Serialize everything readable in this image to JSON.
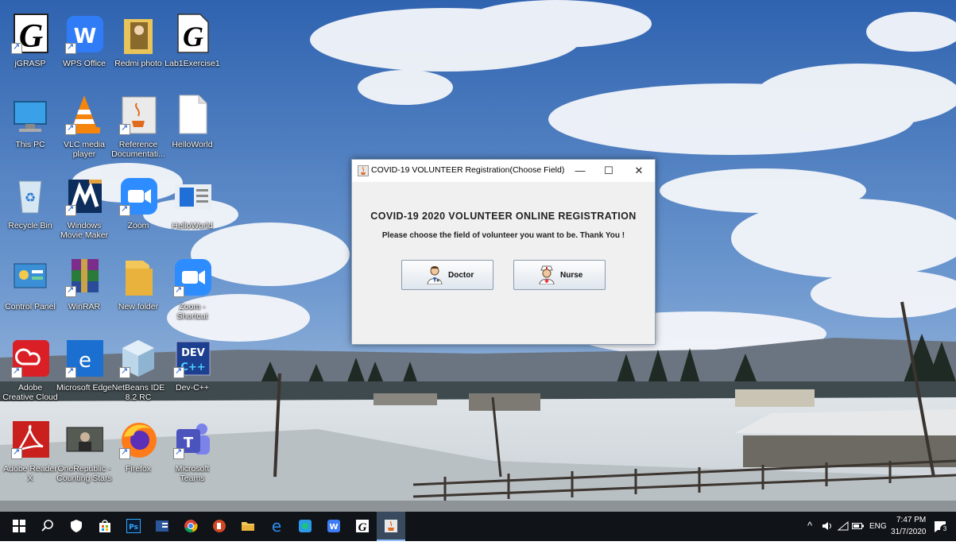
{
  "desktop": {
    "icons": [
      {
        "label": "jGRASP"
      },
      {
        "label": "WPS Office"
      },
      {
        "label": "Redmi photo"
      },
      {
        "label": "Lab1Exercise1"
      },
      {
        "label": "This PC"
      },
      {
        "label": "VLC media player"
      },
      {
        "label": "Reference Documentati..."
      },
      {
        "label": "HelloWorld"
      },
      {
        "label": "Recycle Bin"
      },
      {
        "label": "Windows Movie Maker"
      },
      {
        "label": "Zoom"
      },
      {
        "label": "HelloWorld"
      },
      {
        "label": "Control Panel"
      },
      {
        "label": "WinRAR"
      },
      {
        "label": "New folder"
      },
      {
        "label": "Zoom - Shortcut"
      },
      {
        "label": "Adobe Creative Cloud"
      },
      {
        "label": "Microsoft Edge"
      },
      {
        "label": "NetBeans IDE 8.2 RC"
      },
      {
        "label": "Dev-C++"
      },
      {
        "label": "Adobe Reader X"
      },
      {
        "label": "OneRepublic - Counting Stars"
      },
      {
        "label": "Firefox"
      },
      {
        "label": "Microsoft Teams"
      }
    ]
  },
  "dialog": {
    "title": "COVID-19 VOLUNTEER Registration(Choose Field)",
    "minimize": "—",
    "maximize": "☐",
    "close": "✕",
    "heading": "COVID-19 2020 VOLUNTEER ONLINE REGISTRATION",
    "subheading": "Please choose the field of volunteer you want to be. Thank You !",
    "doctor_label": "Doctor",
    "nurse_label": "Nurse"
  },
  "taskbar": {
    "tray_chevron": "^",
    "language": "ENG",
    "time": "7:47 PM",
    "date": "31/7/2020",
    "notification_count": "3",
    "ps_label": "Ps"
  }
}
